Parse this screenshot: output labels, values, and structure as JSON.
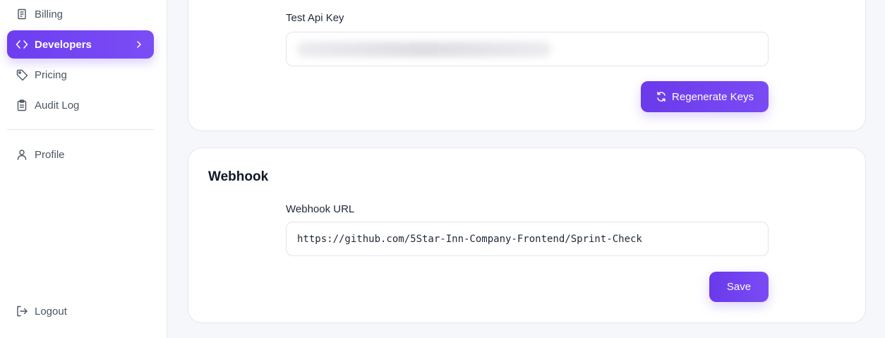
{
  "sidebar": {
    "items": [
      {
        "label": "Billing",
        "icon": "billing-icon"
      },
      {
        "label": "Developers",
        "icon": "code-icon",
        "active": true
      },
      {
        "label": "Pricing",
        "icon": "tag-icon"
      },
      {
        "label": "Audit Log",
        "icon": "clipboard-icon"
      },
      {
        "label": "Profile",
        "icon": "user-icon"
      },
      {
        "label": "Logout",
        "icon": "logout-icon"
      }
    ]
  },
  "api_keys": {
    "test_key_label": "Test Api Key",
    "regenerate_label": "Regenerate Keys"
  },
  "webhook": {
    "title": "Webhook",
    "url_label": "Webhook URL",
    "url_value": "https://github.com/5Star-Inn-Company-Frontend/Sprint-Check",
    "save_label": "Save"
  },
  "colors": {
    "accent": "#6d3ef0",
    "background": "#f6f7fb"
  }
}
